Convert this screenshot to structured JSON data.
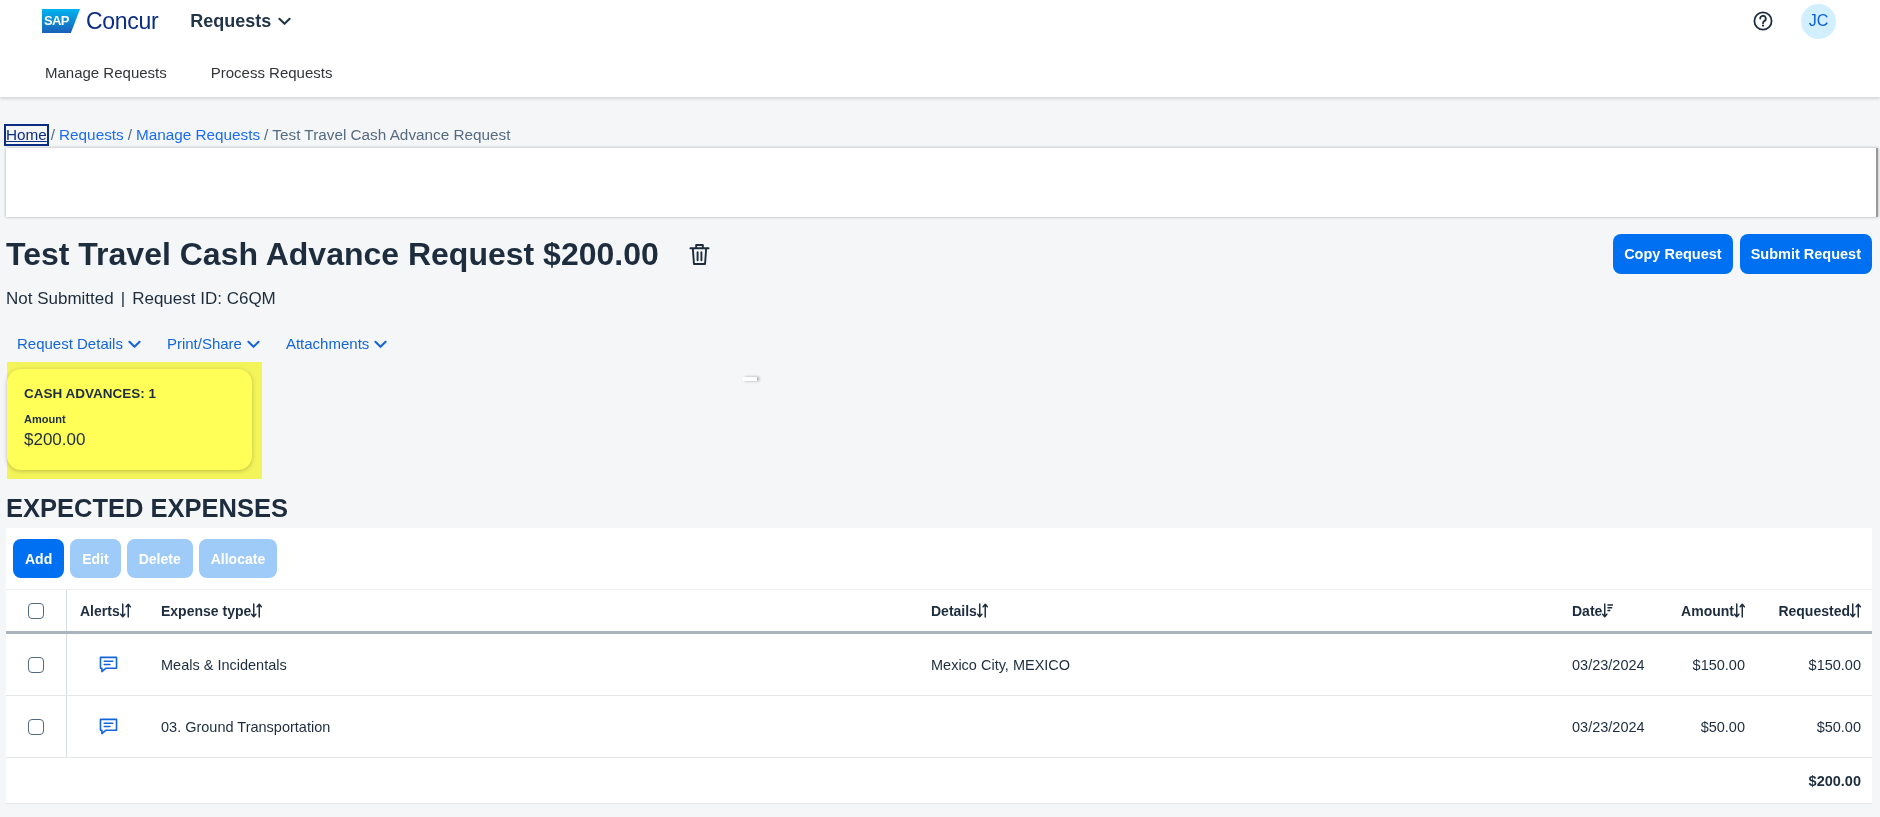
{
  "header": {
    "logo": {
      "mark": "SAP",
      "name": "Concur"
    },
    "app_menu": {
      "label": "Requests",
      "expanded": false
    },
    "avatar": "JC",
    "nav": [
      {
        "label": "Manage Requests",
        "selected": false
      },
      {
        "label": "Process Requests",
        "selected": false
      }
    ]
  },
  "breadcrumb": {
    "separator": "/",
    "items": [
      {
        "label": "Home",
        "kind": "link",
        "focused": true
      },
      {
        "label": "Requests",
        "kind": "link",
        "focused": false
      },
      {
        "label": "Manage Requests",
        "kind": "link",
        "focused": false
      },
      {
        "label": "Test Travel Cash Advance Request",
        "kind": "current",
        "focused": false
      }
    ]
  },
  "title": "Test Travel Cash Advance Request $200.00",
  "status": {
    "state": "Not Submitted",
    "divider": "|",
    "request_id": "Request ID: C6QM"
  },
  "actions": [
    {
      "label": "Copy Request"
    },
    {
      "label": "Submit Request"
    }
  ],
  "tabs": [
    {
      "label": "Request Details",
      "expanded": false
    },
    {
      "label": "Print/Share",
      "expanded": false
    },
    {
      "label": "Attachments",
      "expanded": false
    }
  ],
  "summary_card": {
    "title": "CASH ADVANCES: 1",
    "field_label": "Amount",
    "value": "$200.00",
    "highlighted": true
  },
  "expenses": {
    "heading": "EXPECTED EXPENSES",
    "toolbar": [
      {
        "label": "Add",
        "disabled": false
      },
      {
        "label": "Edit",
        "disabled": true
      },
      {
        "label": "Delete",
        "disabled": true
      },
      {
        "label": "Allocate",
        "disabled": true
      }
    ],
    "select_all": {
      "checked": false
    },
    "columns": [
      {
        "label": "Alerts",
        "sorted": false
      },
      {
        "label": "Expense type",
        "sorted": false
      },
      {
        "label": "Details",
        "sorted": false
      },
      {
        "label": "Date",
        "sorted": true
      },
      {
        "label": "Amount",
        "sorted": false
      },
      {
        "label": "Requested",
        "sorted": false
      }
    ],
    "rows": [
      {
        "selected": false,
        "alert": true,
        "expense_type": "Meals & Incidentals",
        "details": "Mexico City, MEXICO",
        "date": "03/23/2024",
        "amount": "$150.00",
        "requested": "$150.00"
      },
      {
        "selected": false,
        "alert": true,
        "expense_type": "03. Ground Transportation",
        "date": "03/23/2024",
        "amount": "$50.00",
        "requested": "$50.00"
      }
    ],
    "total": "$200.00"
  }
}
